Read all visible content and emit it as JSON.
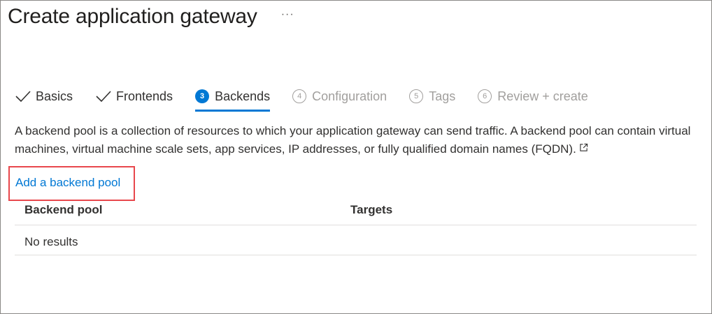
{
  "header": {
    "title": "Create application gateway",
    "more_label": "···"
  },
  "tabs": [
    {
      "label": "Basics",
      "state": "done"
    },
    {
      "label": "Frontends",
      "state": "done"
    },
    {
      "number": "3",
      "label": "Backends",
      "state": "active"
    },
    {
      "number": "4",
      "label": "Configuration",
      "state": "pending"
    },
    {
      "number": "5",
      "label": "Tags",
      "state": "pending"
    },
    {
      "number": "6",
      "label": "Review + create",
      "state": "pending"
    }
  ],
  "description": "A backend pool is a collection of resources to which your application gateway can send traffic. A backend pool can contain virtual machines, virtual machine scale sets, app services, IP addresses, or fully qualified domain names (FQDN).",
  "add_pool_link": "Add a backend pool",
  "table": {
    "columns": [
      "Backend pool",
      "Targets"
    ],
    "empty_text": "No results"
  },
  "colors": {
    "accent": "#0078d4",
    "highlight_box": "#e8474c",
    "pending_text": "#a19f9d"
  }
}
